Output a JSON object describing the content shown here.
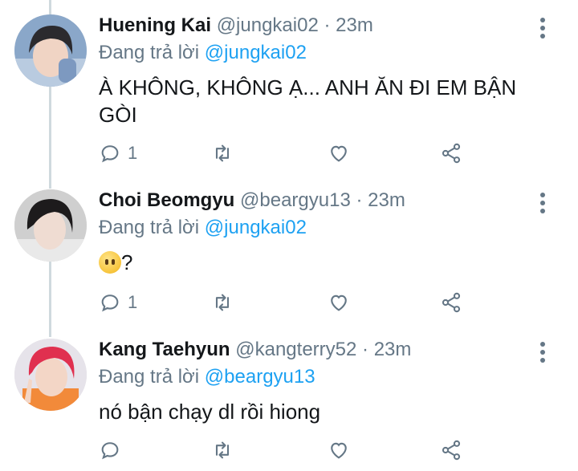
{
  "tweets": [
    {
      "display_name": "Huening Kai",
      "handle": "@jungkai02",
      "separator": "·",
      "time": "23m",
      "reply_prefix": "Đang trả lời",
      "reply_to": "@jungkai02",
      "text": "À KHÔNG, KHÔNG Ạ... ANH ĂN ĐI EM BẬN GÒI",
      "reply_count": "1",
      "avatar_colors": {
        "bg": "#8aa7c9",
        "hair": "#2b2a2e",
        "skin": "#f0d4c4"
      }
    },
    {
      "display_name": "Choi Beomgyu",
      "handle": "@beargyu13",
      "separator": "·",
      "time": "23m",
      "reply_prefix": "Đang trả lời",
      "reply_to": "@jungkai02",
      "text_suffix": "?",
      "reply_count": "1",
      "avatar_colors": {
        "bg": "#cfcfcf",
        "hair": "#1d1b1c",
        "skin": "#efdcd2"
      }
    },
    {
      "display_name": "Kang Taehyun",
      "handle": "@kangterry52",
      "separator": "·",
      "time": "23m",
      "reply_prefix": "Đang trả lời",
      "reply_to": "@beargyu13",
      "text": "nó bận chạy dl rồi hiong",
      "reply_count": "",
      "avatar_colors": {
        "bg": "#e6e3ea",
        "hair": "#e0304f",
        "skin": "#f3d6c6"
      }
    }
  ],
  "colors": {
    "accent": "#1da1f2",
    "muted": "#657786",
    "thread_line": "#cfd9de"
  }
}
